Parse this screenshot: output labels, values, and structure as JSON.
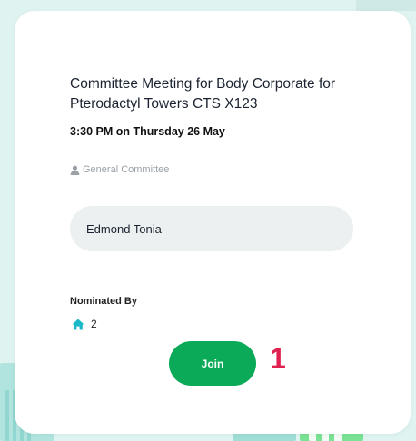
{
  "meeting": {
    "title": "Committee Meeting for Body Corporate for Pterodactyl Towers CTS X123",
    "datetime": "3:30 PM on Thursday 26 May",
    "committee": "General Committee",
    "committee_icon": "user-icon"
  },
  "candidate": {
    "name": "Edmond Tonia"
  },
  "nomination": {
    "label": "Nominated By",
    "icon": "home-icon",
    "count": "2"
  },
  "actions": {
    "join_label": "Join",
    "step_marker": "1"
  },
  "colors": {
    "accent_green": "#0aaa58",
    "marker_red": "#e0204f",
    "home_icon": "#1ab8c8",
    "input_bg": "#edf0f0"
  }
}
